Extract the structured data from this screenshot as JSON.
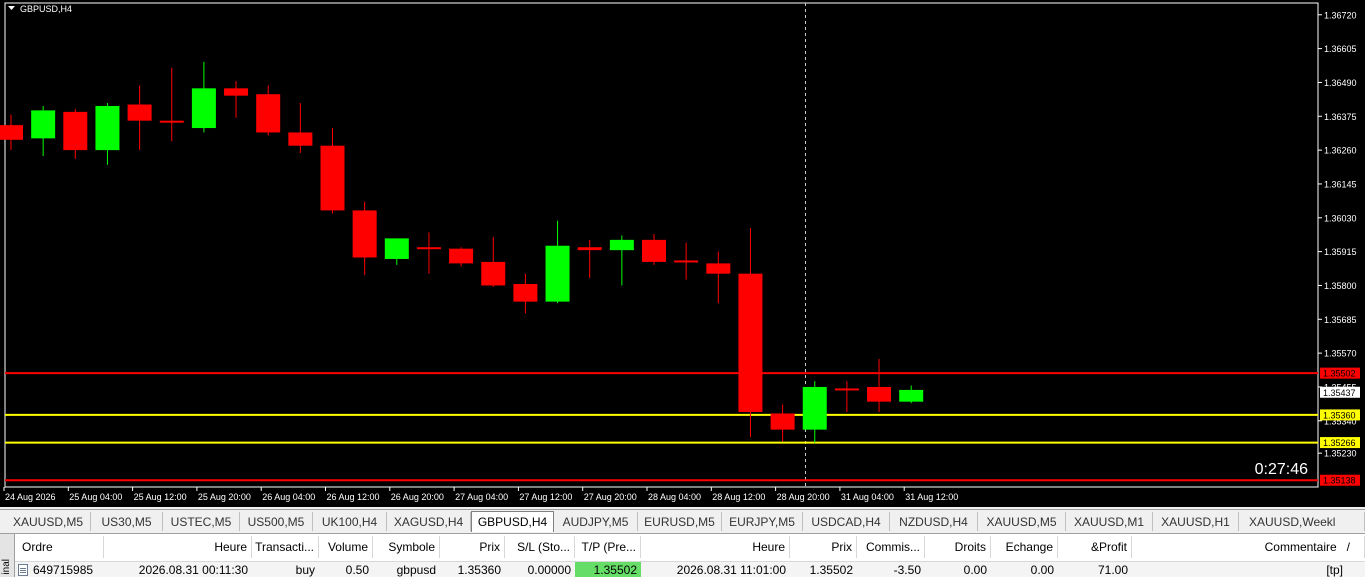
{
  "chart": {
    "title": "GBPUSD,H4",
    "colors": {
      "bull": "#00ff00",
      "bear": "#ff0000",
      "line_red": "#ff0000",
      "line_yellow": "#ffff00",
      "axis": "#ffffff",
      "crosshair": "#c8c8c8"
    },
    "yaxis_min": 1.35115,
    "yaxis_max": 1.3676,
    "price_ticks": [
      "1.36720",
      "1.36605",
      "1.36490",
      "1.36375",
      "1.36260",
      "1.36145",
      "1.36030",
      "1.35915",
      "1.35800",
      "1.35685",
      "1.35570",
      "1.35455",
      "1.35340",
      "1.35230"
    ],
    "price_tags": [
      {
        "value": "1.35502",
        "price": 1.35502,
        "bg": "#ff0000",
        "fg": "#000000",
        "line": "#ff0000"
      },
      {
        "value": "1.35437",
        "price": 1.35437,
        "bg": "#ffffff",
        "fg": "#000000",
        "line": ""
      },
      {
        "value": "1.35360",
        "price": 1.3536,
        "bg": "#ffff00",
        "fg": "#000000",
        "line": "#ffff00"
      },
      {
        "value": "1.35266",
        "price": 1.35266,
        "bg": "#ffff00",
        "fg": "#000000",
        "line": "#ffff00"
      },
      {
        "value": "1.35138",
        "price": 1.35138,
        "bg": "#ff0000",
        "fg": "#000000",
        "line": "#ff0000"
      }
    ],
    "time_labels": [
      "24 Aug 2026",
      "25 Aug 04:00",
      "25 Aug 12:00",
      "25 Aug 20:00",
      "26 Aug 04:00",
      "26 Aug 12:00",
      "26 Aug 20:00",
      "27 Aug 04:00",
      "27 Aug 12:00",
      "27 Aug 20:00",
      "28 Aug 04:00",
      "28 Aug 12:00",
      "28 Aug 20:00",
      "31 Aug 04:00",
      "31 Aug 12:00"
    ],
    "countdown": "0:27:46"
  },
  "chart_data": {
    "type": "candlestick",
    "candles": [
      {
        "o": 1.36345,
        "h": 1.3638,
        "l": 1.3626,
        "c": 1.36295
      },
      {
        "o": 1.363,
        "h": 1.3641,
        "l": 1.3624,
        "c": 1.36395
      },
      {
        "o": 1.3639,
        "h": 1.364,
        "l": 1.3623,
        "c": 1.3626
      },
      {
        "o": 1.3626,
        "h": 1.3642,
        "l": 1.3621,
        "c": 1.3641
      },
      {
        "o": 1.36415,
        "h": 1.3648,
        "l": 1.3626,
        "c": 1.3636
      },
      {
        "o": 1.3636,
        "h": 1.3654,
        "l": 1.3629,
        "c": 1.36355
      },
      {
        "o": 1.36335,
        "h": 1.3656,
        "l": 1.3632,
        "c": 1.3647
      },
      {
        "o": 1.3647,
        "h": 1.36495,
        "l": 1.3637,
        "c": 1.36445
      },
      {
        "o": 1.3645,
        "h": 1.3648,
        "l": 1.3631,
        "c": 1.3632
      },
      {
        "o": 1.3632,
        "h": 1.3642,
        "l": 1.3625,
        "c": 1.36275
      },
      {
        "o": 1.36275,
        "h": 1.36335,
        "l": 1.36045,
        "c": 1.36055
      },
      {
        "o": 1.36055,
        "h": 1.36085,
        "l": 1.35835,
        "c": 1.35895
      },
      {
        "o": 1.3589,
        "h": 1.3596,
        "l": 1.3587,
        "c": 1.3596
      },
      {
        "o": 1.3593,
        "h": 1.3598,
        "l": 1.3584,
        "c": 1.35925
      },
      {
        "o": 1.35925,
        "h": 1.3593,
        "l": 1.35865,
        "c": 1.35875
      },
      {
        "o": 1.3588,
        "h": 1.35965,
        "l": 1.35795,
        "c": 1.358
      },
      {
        "o": 1.35805,
        "h": 1.3584,
        "l": 1.35705,
        "c": 1.35745
      },
      {
        "o": 1.35745,
        "h": 1.3602,
        "l": 1.3574,
        "c": 1.35935
      },
      {
        "o": 1.3593,
        "h": 1.35955,
        "l": 1.35825,
        "c": 1.3592
      },
      {
        "o": 1.3592,
        "h": 1.3597,
        "l": 1.358,
        "c": 1.35955
      },
      {
        "o": 1.35955,
        "h": 1.35975,
        "l": 1.3587,
        "c": 1.3588
      },
      {
        "o": 1.35885,
        "h": 1.35945,
        "l": 1.3582,
        "c": 1.3588
      },
      {
        "o": 1.35875,
        "h": 1.35915,
        "l": 1.3574,
        "c": 1.3584
      },
      {
        "o": 1.3584,
        "h": 1.35995,
        "l": 1.35285,
        "c": 1.3537
      },
      {
        "o": 1.35365,
        "h": 1.35395,
        "l": 1.3527,
        "c": 1.3531
      },
      {
        "o": 1.3531,
        "h": 1.35475,
        "l": 1.35265,
        "c": 1.35455
      },
      {
        "o": 1.3545,
        "h": 1.35475,
        "l": 1.3537,
        "c": 1.35445
      },
      {
        "o": 1.35455,
        "h": 1.3555,
        "l": 1.3537,
        "c": 1.35405
      },
      {
        "o": 1.35405,
        "h": 1.3546,
        "l": 1.354,
        "c": 1.35445
      }
    ]
  },
  "tabs": [
    {
      "label": "XAUUSD,M5",
      "active": false
    },
    {
      "label": "US30,M5",
      "active": false
    },
    {
      "label": "USTEC,M5",
      "active": false
    },
    {
      "label": "US500,M5",
      "active": false
    },
    {
      "label": "UK100,H4",
      "active": false
    },
    {
      "label": "XAGUSD,H4",
      "active": false
    },
    {
      "label": "GBPUSD,H4",
      "active": true
    },
    {
      "label": "AUDJPY,M5",
      "active": false
    },
    {
      "label": "EURUSD,M5",
      "active": false
    },
    {
      "label": "EURJPY,M5",
      "active": false
    },
    {
      "label": "USDCAD,H4",
      "active": false
    },
    {
      "label": "NZDUSD,H4",
      "active": false
    },
    {
      "label": "XAUUSD,M5",
      "active": false
    },
    {
      "label": "XAUUSD,M1",
      "active": false
    },
    {
      "label": "XAUUSD,H1",
      "active": false
    },
    {
      "label": "XAUUSD,Weekl",
      "active": false
    }
  ],
  "terminal": {
    "side_label": "inal",
    "headers": [
      "Ordre",
      "Heure",
      "Transacti...",
      "Volume",
      "Symbole",
      "Prix",
      "S/L (Sto...",
      "T/P (Pre...",
      "Heure",
      "Prix",
      "Commis...",
      "Droits",
      "Echange",
      "&Profit",
      "Commentaire"
    ],
    "sort_indicator": "/",
    "row": [
      "649715985",
      "2026.08.31 00:11:30",
      "buy",
      "0.50",
      "gbpusd",
      "1.35360",
      "0.00000",
      "1.35502",
      "2026.08.31 11:01:00",
      "1.35502",
      "-3.50",
      "0.00",
      "0.00",
      "71.00",
      "[tp]"
    ],
    "tp_highlight": "#66dd66"
  }
}
